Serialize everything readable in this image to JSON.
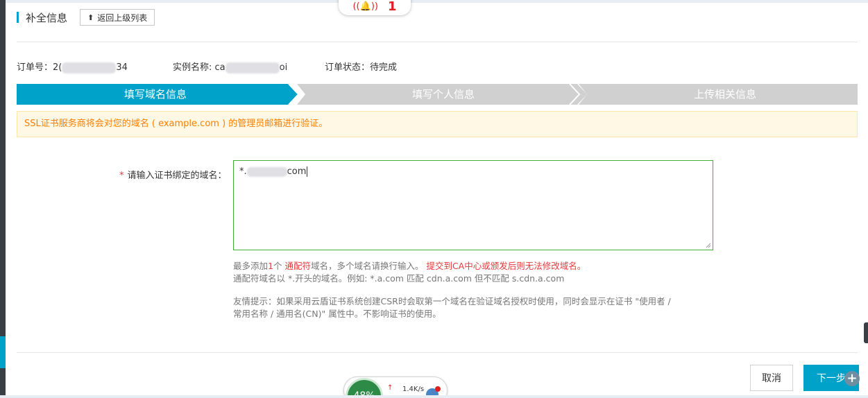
{
  "header": {
    "title": "补全信息",
    "back_label": "返回上级列表",
    "back_icon": "arrow-up-icon"
  },
  "notification": {
    "icon": "bell-icon",
    "count": "1"
  },
  "order": {
    "number_label": "订单号：",
    "number_start": "2(",
    "number_end": "34",
    "instance_label": "实例名称:",
    "instance_start": "ca",
    "instance_end": "oi",
    "status_label": "订单状态：",
    "status_value": "待完成"
  },
  "steps": [
    {
      "label": "填写域名信息",
      "active": true
    },
    {
      "label": "填写个人信息",
      "active": false
    },
    {
      "label": "上传相关信息",
      "active": false
    }
  ],
  "colors": {
    "step_active": "#00a2ca",
    "step_inactive": "#d0d0d0",
    "alert_text": "#ff7e00",
    "required": "#e4393c",
    "field_border": "#3eb135"
  },
  "alert": {
    "text": "SSL证书服务商将会对您的域名 ( example.com ) 的管理员邮箱进行验证。"
  },
  "form": {
    "required_mark": "*",
    "domain_label": "请输入证书绑定的域名：",
    "domain_value_start": "*.",
    "domain_value_end": "com",
    "help_line1_a": "最多添加",
    "help_line1_b": "1",
    "help_line1_c": "个 ",
    "help_line1_d": "通配符",
    "help_line1_e": "域名，多个域名请换行输入。 ",
    "help_line1_f": "提交到CA中心或颁发后则无法修改域名。",
    "help_line2": "通配符域名以 *.开头的域名。例如: *.a.com 匹配 cdn.a.com 但不匹配 s.cdn.a.com",
    "help_line3": "友情提示：如果采用云盾证书系统创建CSR时会取第一个域名在验证域名授权时使用，同时会显示在证书 \"使用者 /",
    "help_line4": "常用名称 / 通用名(CN)\" 属性中。不影响证书的使用。"
  },
  "footer": {
    "cancel_label": "取消",
    "next_label": "下一步"
  },
  "speed_widget": {
    "percent": "48%",
    "rate": "1.4K/s"
  }
}
